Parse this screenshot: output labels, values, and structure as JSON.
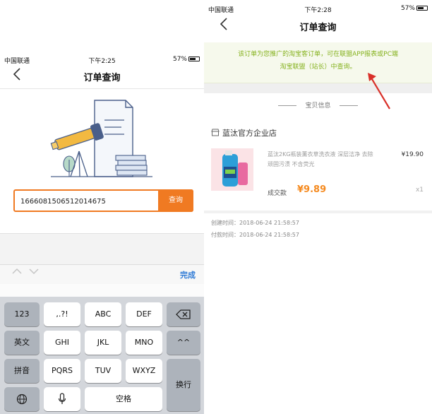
{
  "left_screen": {
    "status_bar": {
      "carrier": "中国联通",
      "time": "下午2:25",
      "battery": "57%"
    },
    "nav": {
      "back_icon": "chevron-left-icon",
      "title": "订单查询"
    },
    "search": {
      "value": "1666081506512014675",
      "button_label": "查询"
    },
    "accessory": {
      "prev_icon": "chevron-up-icon",
      "next_icon": "chevron-down-icon",
      "done_label": "完成"
    },
    "keyboard": {
      "rows": [
        [
          "123",
          ",.?!",
          "ABC",
          "DEF"
        ],
        [
          "英文",
          "GHI",
          "JKL",
          "MNO"
        ],
        [
          "拼音",
          "PQRS",
          "TUV",
          "WXYZ"
        ]
      ],
      "delete_icon": "backspace-icon",
      "emoji_key": "^^",
      "globe_icon": "globe-icon",
      "mic_icon": "microphone-icon",
      "space_label": "空格",
      "return_label": "换行"
    }
  },
  "right_screen": {
    "status_bar": {
      "carrier": "中国联通",
      "time": "下午2:28",
      "battery": "57%"
    },
    "nav": {
      "back_icon": "chevron-left-icon",
      "title": "订单查询"
    },
    "notice_line1": "该订单为您推广的淘宝客订单，可在联盟APP报表或PC端",
    "notice_line2": "淘宝联盟（站长）中查询。",
    "section_title": "宝贝信息",
    "shop_icon": "shop-icon",
    "shop_name": "蓝汰官方企业店",
    "product": {
      "name": "蓝汰2KG瓶装薰衣草洗衣液 深层洁净 去除顽固污渍 不含荧光",
      "price": "¥19.90",
      "quantity": "x1",
      "deal_label": "成交款",
      "deal_amount": "¥9.89"
    },
    "created_label": "创建时间：2018-06-24 21:58:57",
    "paid_label": "付款时间：2018-06-24 21:58:57"
  },
  "colors": {
    "accent_orange": "#f07a22",
    "notice_green": "#86b21f",
    "link_blue": "#2f7bd6",
    "arrow_red": "#d9312a"
  }
}
